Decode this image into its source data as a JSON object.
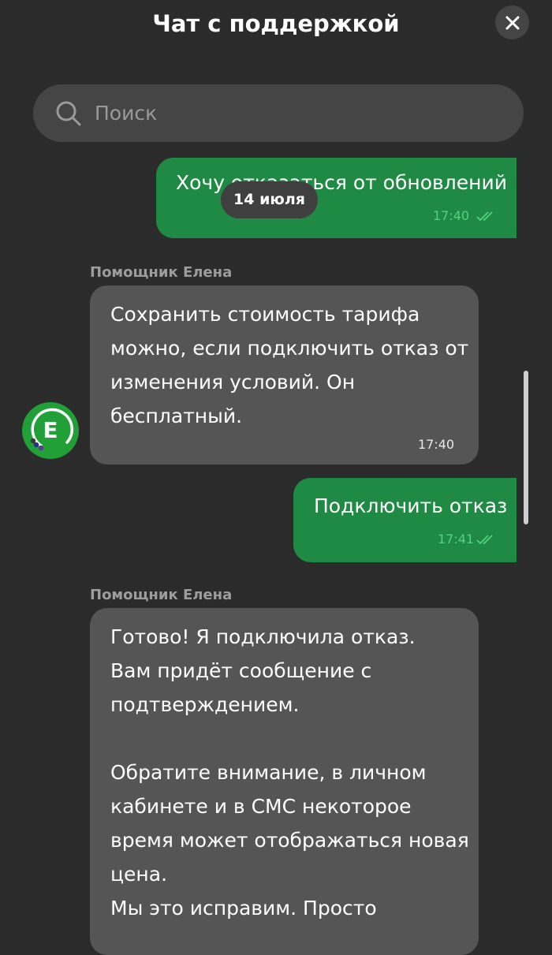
{
  "header": {
    "title": "Чат с поддержкой"
  },
  "search": {
    "placeholder": "Поиск"
  },
  "date_separator": "14 июля",
  "messages": [
    {
      "direction": "outgoing",
      "text": "Хочу отказаться от обновлений",
      "time": "17:40",
      "status": "read"
    },
    {
      "direction": "incoming",
      "sender": "Помощник Елена",
      "text": "Сохранить стоимость тарифа\nможно, если подключить отказ от\nизменения условий. Он\nбесплатный.",
      "time": "17:40"
    },
    {
      "direction": "outgoing",
      "text": "Подключить отказ",
      "time": "17:41",
      "status": "read"
    },
    {
      "direction": "incoming",
      "sender": "Помощник Елена",
      "text": "Готово! Я подключила отказ.\nВам придёт сообщение с\nподтверждением.\n\nОбратите внимание, в личном\nкабинете и в СМС некоторое\nвремя может отображаться новая\nцена.\nМы это исправим. Просто"
    }
  ],
  "avatar": {
    "letter": "Е"
  },
  "icons": {
    "close": "close-icon",
    "search": "search-icon",
    "read_receipt": "double-check-icon"
  },
  "colors": {
    "background": "#2b2b2b",
    "outgoing_bubble": "#1f8a43",
    "incoming_bubble": "#555555",
    "accent": "#21a038"
  }
}
